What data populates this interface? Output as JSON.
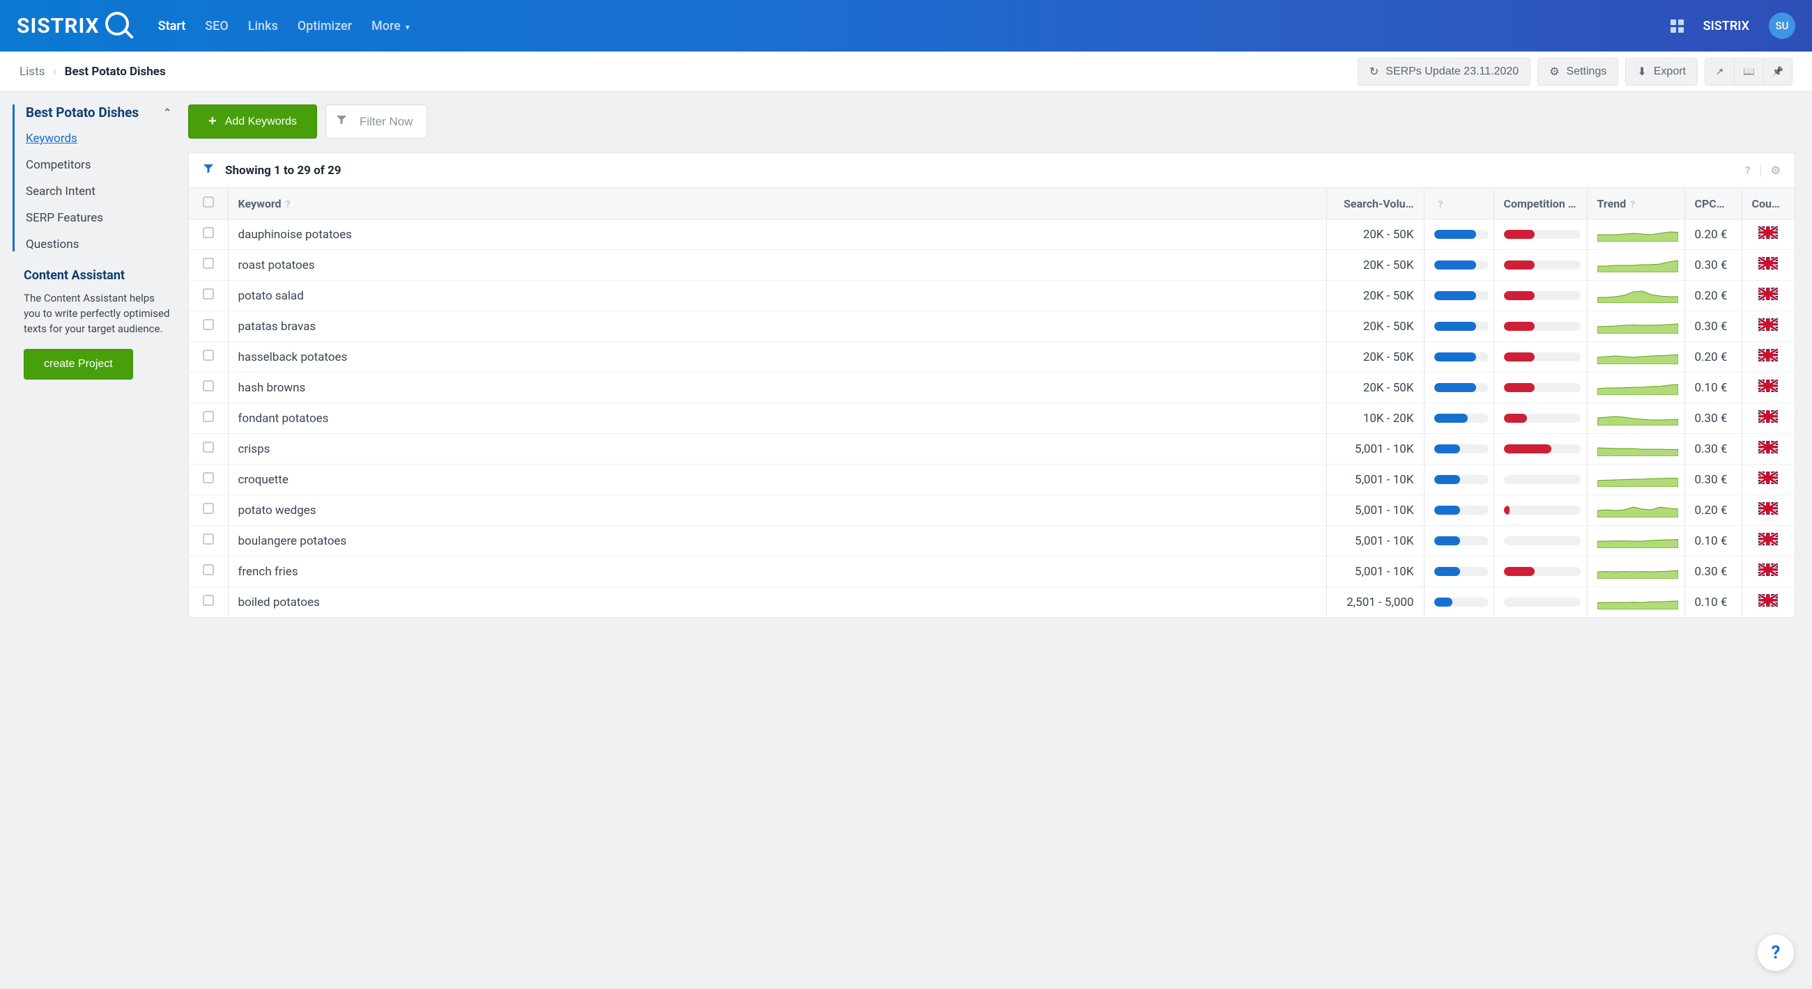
{
  "brand": {
    "name": "SISTRIX",
    "avatar_initials": "SU"
  },
  "nav": {
    "items": [
      "Start",
      "SEO",
      "Links",
      "Optimizer",
      "More"
    ],
    "active_index": 0,
    "right_label": "SISTRIX"
  },
  "breadcrumb": {
    "parent": "Lists",
    "current": "Best Potato Dishes"
  },
  "toolbar": {
    "serps_update": "SERPs Update 23.11.2020",
    "settings": "Settings",
    "export": "Export"
  },
  "sidebar": {
    "title": "Best Potato Dishes",
    "items": [
      "Keywords",
      "Competitors",
      "Search Intent",
      "SERP Features",
      "Questions"
    ],
    "active_index": 0,
    "content_assist_title": "Content Assistant",
    "content_assist_text": "The Content Assistant helps you to write perfectly optimised texts for your target audience.",
    "create_project": "create Project"
  },
  "actions": {
    "add_keywords": "Add Keywords",
    "filter_now": "Filter Now"
  },
  "results": {
    "showing": "Showing 1 to 29 of 29",
    "columns": {
      "keyword": "Keyword",
      "search_volume": "Search-Volu…",
      "bar": "",
      "competition": "Competition …",
      "trend": "Trend",
      "cpc": "CPC…",
      "country": "Count…"
    },
    "rows": [
      {
        "keyword": "dauphinoise potatoes",
        "volume": "20K - 50K",
        "vol_pct": 78,
        "comp_pct": 40,
        "cpc": "0.20 €",
        "country": "uk",
        "spark": "0.5 0.5 0.5 0.55 0.6 0.55 0.5 0.6 0.7 0.68"
      },
      {
        "keyword": "roast potatoes",
        "volume": "20K - 50K",
        "vol_pct": 78,
        "comp_pct": 40,
        "cpc": "0.30 €",
        "country": "uk",
        "spark": "0.45 0.45 0.5 0.5 0.5 0.55 0.55 0.6 0.75 0.85"
      },
      {
        "keyword": "potato salad",
        "volume": "20K - 50K",
        "vol_pct": 78,
        "comp_pct": 40,
        "cpc": "0.20 €",
        "country": "uk",
        "spark": "0.4 0.4 0.45 0.55 0.8 0.85 0.6 0.5 0.45 0.45"
      },
      {
        "keyword": "patatas bravas",
        "volume": "20K - 50K",
        "vol_pct": 78,
        "comp_pct": 40,
        "cpc": "0.30 €",
        "country": "uk",
        "spark": "0.5 0.52 0.55 0.6 0.62 0.6 0.6 0.62 0.65 0.7"
      },
      {
        "keyword": "hasselback potatoes",
        "volume": "20K - 50K",
        "vol_pct": 78,
        "comp_pct": 40,
        "cpc": "0.20 €",
        "country": "uk",
        "spark": "0.5 0.55 0.6 0.55 0.5 0.55 0.6 0.62 0.65 0.68"
      },
      {
        "keyword": "hash browns",
        "volume": "20K - 50K",
        "vol_pct": 78,
        "comp_pct": 40,
        "cpc": "0.10 €",
        "country": "uk",
        "spark": "0.45 0.5 0.5 0.52 0.55 0.55 0.6 0.62 0.7 0.75"
      },
      {
        "keyword": "fondant potatoes",
        "volume": "10K - 20K",
        "vol_pct": 62,
        "comp_pct": 30,
        "cpc": "0.30 €",
        "country": "uk",
        "spark": "0.55 0.6 0.65 0.6 0.5 0.45 0.4 0.4 0.42 0.45"
      },
      {
        "keyword": "crisps",
        "volume": "5,001 - 10K",
        "vol_pct": 48,
        "comp_pct": 62,
        "cpc": "0.30 €",
        "country": "uk",
        "spark": "0.6 0.58 0.55 0.55 0.55 0.5 0.5 0.5 0.48 0.48"
      },
      {
        "keyword": "croquette",
        "volume": "5,001 - 10K",
        "vol_pct": 48,
        "comp_pct": 0,
        "cpc": "0.30 €",
        "country": "uk",
        "spark": "0.45 0.48 0.5 0.52 0.55 0.55 0.58 0.6 0.62 0.62"
      },
      {
        "keyword": "potato wedges",
        "volume": "5,001 - 10K",
        "vol_pct": 48,
        "comp_pct": 8,
        "cpc": "0.20 €",
        "country": "uk",
        "spark": "0.5 0.55 0.5 0.55 0.75 0.6 0.55 0.75 0.65 0.6"
      },
      {
        "keyword": "boulangere potatoes",
        "volume": "5,001 - 10K",
        "vol_pct": 48,
        "comp_pct": 0,
        "cpc": "0.10 €",
        "country": "uk",
        "spark": "0.5 0.5 0.52 0.52 0.5 0.5 0.55 0.58 0.6 0.62"
      },
      {
        "keyword": "french fries",
        "volume": "5,001 - 10K",
        "vol_pct": 48,
        "comp_pct": 40,
        "cpc": "0.30 €",
        "country": "uk",
        "spark": "0.5 0.52 0.5 0.52 0.5 0.52 0.5 0.52 0.55 0.58"
      },
      {
        "keyword": "boiled potatoes",
        "volume": "2,501 - 5,000",
        "vol_pct": 34,
        "comp_pct": 0,
        "cpc": "0.10 €",
        "country": "uk",
        "spark": "0.48 0.5 0.5 0.5 0.52 0.5 0.55 0.55 0.58 0.6"
      }
    ]
  }
}
